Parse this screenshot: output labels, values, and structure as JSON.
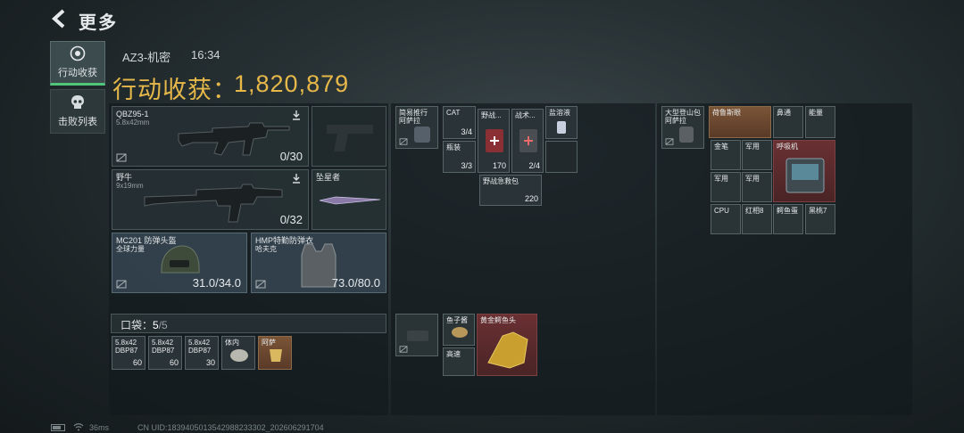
{
  "header": {
    "title": "更多"
  },
  "nav": [
    {
      "label": "行动收获"
    },
    {
      "label": "击败列表"
    }
  ],
  "session": {
    "label": "AZ3-机密",
    "time": "16:34"
  },
  "haul": {
    "label": "行动收获：",
    "value": "1,820,879"
  },
  "equipment": {
    "primary": {
      "name": "QBZ95-1",
      "caliber": "5.8x42mm",
      "ammo": "0/30"
    },
    "secondary": {
      "name": "野牛",
      "caliber": "9x19mm",
      "ammo": "0/32"
    },
    "melee": {
      "name": "坠星者"
    },
    "helmet": {
      "name": "MC201 防弹头盔",
      "maker": "全球力量",
      "durability": "31.0/34.0"
    },
    "armor": {
      "name": "HMP特勤防弹衣",
      "maker": "哈夫克",
      "durability": "73.0/80.0"
    }
  },
  "pocket": {
    "label": "口袋：",
    "used": "5",
    "capacity": "/5",
    "items": [
      {
        "name": "5.8x42",
        "sub": "DBP87",
        "value": "60"
      },
      {
        "name": "5.8x42",
        "sub": "DBP87",
        "value": "60"
      },
      {
        "name": "5.8x42",
        "sub": "DBP87",
        "value": "30"
      },
      {
        "name": "体内"
      },
      {
        "name": "阿萨"
      }
    ]
  },
  "chest_rig": {
    "items": [
      {
        "name": "简易推行",
        "sub": "阿萨拉"
      },
      {
        "name": "CAT",
        "value": "3/4"
      },
      {
        "name": "野战..."
      },
      {
        "name": "战术..."
      },
      {
        "name": "盐溶液"
      },
      {
        "name": "瓶装",
        "value": "3/3"
      },
      {
        "value": "170"
      },
      {
        "value": "2/4"
      },
      {
        "name": "野战急救包",
        "value": "220"
      }
    ]
  },
  "bag": {
    "items": [
      {
        "name": "鱼子酱"
      },
      {
        "name": "黄金鳄鱼头"
      },
      {
        "name": "高速"
      }
    ]
  },
  "backpack": {
    "pack": {
      "name": "大型登山包",
      "sub": "阿萨拉"
    },
    "items": [
      {
        "name": "荷鲁斯眼"
      },
      {
        "name": "鼻通"
      },
      {
        "name": "能量"
      },
      {
        "name": "金笔"
      },
      {
        "name": "军用"
      },
      {
        "name": "呼吸机"
      },
      {
        "name": "军用"
      },
      {
        "name": "军用"
      },
      {
        "name": "CPU"
      },
      {
        "name": "红相8"
      },
      {
        "name": "鳄鱼蛋"
      },
      {
        "name": "黑桃7"
      }
    ]
  },
  "footer": {
    "ping": "36ms",
    "uid": "CN UID:1839405013542988233302_202606291704"
  },
  "colors": {
    "accent": "#e6b84a",
    "active_tab": "#4fc67a",
    "panel": "#141b1e"
  }
}
